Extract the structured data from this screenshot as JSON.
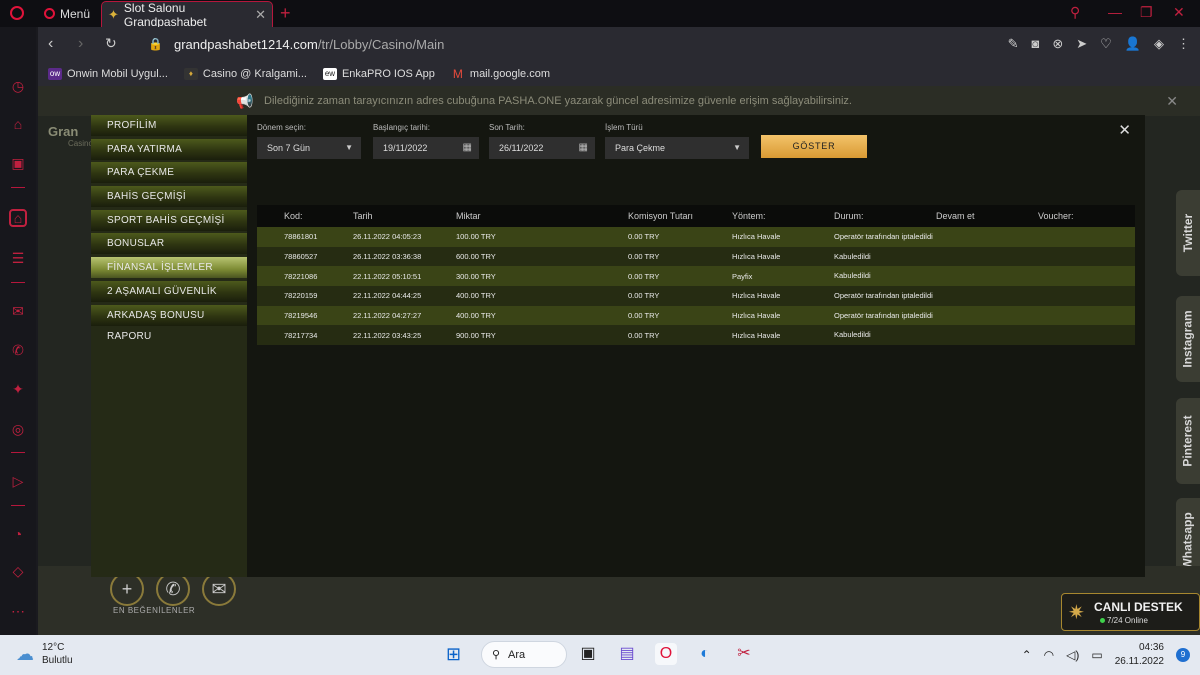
{
  "browser": {
    "menu_label": "Menü",
    "tab_title": "Slot Salonu Grandpashabet",
    "url_domain": "grandpashabet1214.com",
    "url_path": "/tr/Lobby/Casino/Main",
    "bookmarks": [
      {
        "label": "Onwin Mobil Uygul...",
        "icon": "onwin-icon",
        "color": "#5b2a8a"
      },
      {
        "label": "Casino @ Kralgami...",
        "icon": "casino-icon",
        "color": "#222222"
      },
      {
        "label": "EnkaPRO IOS App",
        "icon": "enkapro-icon",
        "color": "#ffffff"
      },
      {
        "label": "mail.google.com",
        "icon": "gmail-icon",
        "color": "#ffffff"
      }
    ]
  },
  "notice": {
    "text": "Dilediğiniz zaman tarayıcınızın adres cubuğuna PASHA.ONE yazarak güncel adresimize güvenle erişim sağlayabilirsiniz."
  },
  "site": {
    "logo_text": "Gran",
    "logo_sub": "Casino",
    "favorites_label": "EN BEĞENİLENLER",
    "social_tabs": [
      "Twitter",
      "Instagram",
      "Pinterest",
      "Whatsapp"
    ]
  },
  "account_menu": [
    "PROFİLİM",
    "PARA YATIRMA",
    "PARA ÇEKME",
    "BAHİS GEÇMİŞİ",
    "SPORT BAHİS GEÇMİŞİ",
    "BONUSLAR",
    "FİNANSAL İŞLEMLER",
    "2 AŞAMALI GÜVENLİK",
    "ARKADAŞ BONUSU RAPORU"
  ],
  "account_menu_active_index": 6,
  "filters": {
    "period_label": "Dönem seçin:",
    "period_value": "Son 7 Gün",
    "start_label": "Başlangıç tarihi:",
    "start_value": "19/11/2022",
    "end_label": "Son Tarih:",
    "end_value": "26/11/2022",
    "type_label": "İşlem Türü",
    "type_value": "Para Çekme",
    "show_button": "GÖSTER"
  },
  "table": {
    "headers": [
      "Kod:",
      "Tarih",
      "Miktar",
      "Komisyon Tutarı",
      "Yöntem:",
      "Durum:",
      "Devam et",
      "Voucher:"
    ],
    "rows": [
      [
        "78861801",
        "26.11.2022 04:05:23",
        "100.00 TRY",
        "0.00 TRY",
        "Hızlıca Havale",
        "Operatör tarafından iptaledildi",
        "",
        ""
      ],
      [
        "78860527",
        "26.11.2022 03:36:38",
        "600.00 TRY",
        "0.00 TRY",
        "Hızlıca Havale",
        "Kabuledildi",
        "",
        ""
      ],
      [
        "78221086",
        "22.11.2022 05:10:51",
        "300.00 TRY",
        "0.00 TRY",
        "Payfix",
        "Kabuledildi",
        "",
        ""
      ],
      [
        "78220159",
        "22.11.2022 04:44:25",
        "400.00 TRY",
        "0.00 TRY",
        "Hızlıca Havale",
        "Operatör tarafından iptaledildi",
        "",
        ""
      ],
      [
        "78219546",
        "22.11.2022 04:27:27",
        "400.00 TRY",
        "0.00 TRY",
        "Hızlıca Havale",
        "Operatör tarafından iptaledildi",
        "",
        ""
      ],
      [
        "78217734",
        "22.11.2022 03:43:25",
        "900.00 TRY",
        "0.00 TRY",
        "Hızlıca Havale",
        "Kabuledildi",
        "",
        ""
      ]
    ]
  },
  "live_support": {
    "title": "CANLI DESTEK",
    "subtitle": "7/24 Online"
  },
  "taskbar": {
    "temp": "12°C",
    "weather": "Bulutlu",
    "search_label": "Ara",
    "time": "04:36",
    "date": "26.11.2022",
    "notifications": "9"
  }
}
